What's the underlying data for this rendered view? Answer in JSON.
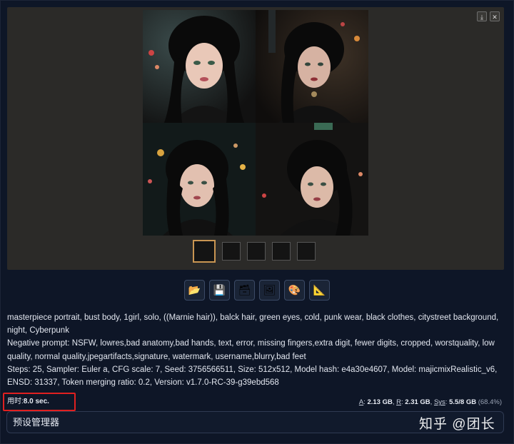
{
  "gallery": {
    "download_icon": "download-icon",
    "close_icon": "close-icon",
    "download_glyph": "⤓",
    "close_glyph": "✕",
    "thumbnail_count": 5,
    "selected_thumbnail": 1
  },
  "actions": [
    {
      "name": "open-folder-button",
      "icon": "folder-icon",
      "glyph": "📂"
    },
    {
      "name": "save-button",
      "icon": "floppy-disk-icon",
      "glyph": "💾"
    },
    {
      "name": "zip-button",
      "icon": "stack-icon",
      "glyph": "🗃"
    },
    {
      "name": "send-to-img2img-button",
      "icon": "picture-icon",
      "glyph": "🖼"
    },
    {
      "name": "send-to-inpaint-button",
      "icon": "palette-icon",
      "glyph": "🎨"
    },
    {
      "name": "send-to-extras-button",
      "icon": "ruler-triangle-icon",
      "glyph": "📐"
    }
  ],
  "info": {
    "prompt": "masterpiece portrait, bust body, 1girl, solo, ((Marnie hair)), balck hair, green eyes, cold, punk wear, black clothes, citystreet background, night, Cyberpunk",
    "negative": "Negative prompt: NSFW, lowres,bad anatomy,bad hands, text, error, missing fingers,extra digit, fewer digits, cropped, worstquality, low quality, normal quality,jpegartifacts,signature, watermark, username,blurry,bad feet",
    "params": "Steps: 25, Sampler: Euler a, CFG scale: 7, Seed: 3756566511, Size: 512x512, Model hash: e4a30e4607, Model: majicmixRealistic_v6, ENSD: 31337, Token merging ratio: 0.2, Version: v1.7.0-RC-39-g39ebd568"
  },
  "timing": {
    "label": "用时:",
    "value": "8.0 sec."
  },
  "memory": {
    "a_label": "A",
    "a_value": "2.13 GB",
    "r_label": "R",
    "r_value": "2.31 GB",
    "sys_label": "Sys",
    "sys_value": "5.5/8 GB",
    "sys_pct": "(68.4%)"
  },
  "preset_bar": {
    "label": "预设管理器"
  },
  "watermark": {
    "text": "知乎 @团长"
  },
  "colors": {
    "background": "#0e1627",
    "gallery_bg": "#2b2a28",
    "highlight_border": "#e02020",
    "selected_thumb_border": "#c99552"
  }
}
